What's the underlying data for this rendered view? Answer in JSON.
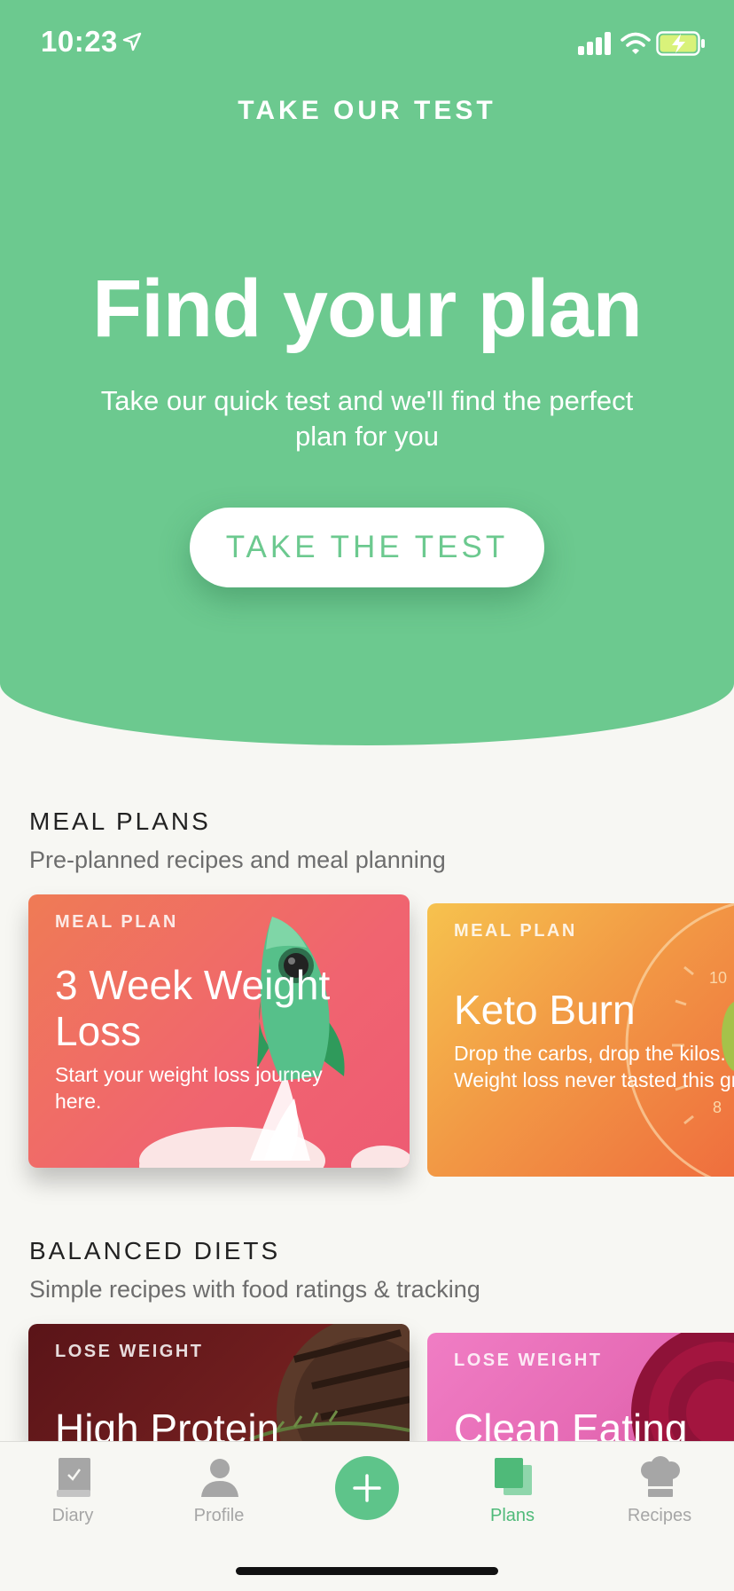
{
  "status_bar": {
    "time": "10:23"
  },
  "hero": {
    "top_link": "TAKE OUR TEST",
    "title": "Find your plan",
    "subtitle": "Take our quick test and we'll find the perfect plan for you",
    "button_label": "TAKE THE TEST"
  },
  "meal_plans": {
    "title": "MEAL PLANS",
    "subtitle": "Pre-planned recipes and meal planning",
    "cards": [
      {
        "tag": "MEAL PLAN",
        "title": "3 Week Weight Loss",
        "description": "Start your weight loss journey here."
      },
      {
        "tag": "MEAL PLAN",
        "title": "Keto Burn",
        "description": "Drop the carbs, drop the kilos. Weight loss never tasted this great!"
      }
    ]
  },
  "balanced_diets": {
    "title": "BALANCED DIETS",
    "subtitle": "Simple recipes with food ratings & tracking",
    "cards": [
      {
        "tag": "LOSE WEIGHT",
        "title": "High Protein"
      },
      {
        "tag": "LOSE WEIGHT",
        "title": "Clean Eating"
      }
    ]
  },
  "tab_bar": {
    "items": [
      {
        "label": "Diary",
        "icon": "diary-icon"
      },
      {
        "label": "Profile",
        "icon": "profile-icon"
      },
      {
        "label": "Plans",
        "icon": "plans-icon",
        "active": true
      },
      {
        "label": "Recipes",
        "icon": "chef-hat-icon"
      }
    ],
    "add_icon": "plus-icon"
  },
  "colors": {
    "accent": "#6cc98f",
    "active_tab": "#4fba79",
    "background": "#f7f7f3"
  }
}
